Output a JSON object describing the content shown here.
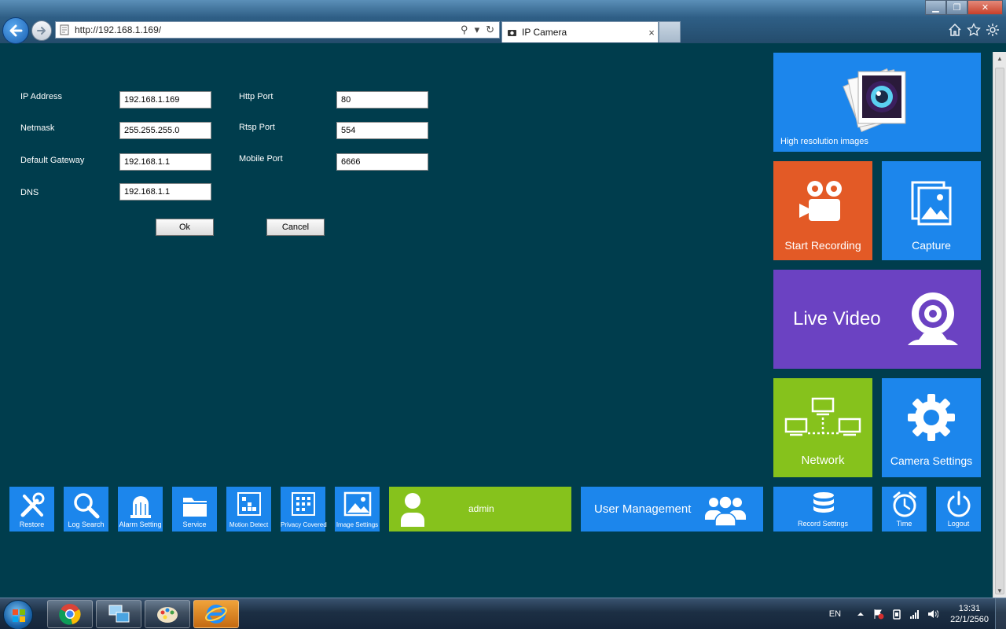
{
  "browser": {
    "url": "http://192.168.1.169/",
    "tab_title": "IP Camera",
    "tab_close": "×"
  },
  "network_form": {
    "ip_address": {
      "label": "IP Address",
      "value": "192.168.1.169"
    },
    "netmask": {
      "label": "Netmask",
      "value": "255.255.255.0"
    },
    "gateway": {
      "label": "Default Gateway",
      "value": "192.168.1.1"
    },
    "dns": {
      "label": "DNS",
      "value": "192.168.1.1"
    },
    "http_port": {
      "label": "Http Port",
      "value": "80"
    },
    "rtsp_port": {
      "label": "Rtsp Port",
      "value": "554"
    },
    "mobile_port": {
      "label": "Mobile Port",
      "value": "6666"
    },
    "ok_label": "Ok",
    "cancel_label": "Cancel"
  },
  "tiles": {
    "high_res": "High resolution images",
    "start_recording": "Start Recording",
    "capture": "Capture",
    "live_video": "Live Video",
    "network": "Network",
    "camera_settings": "Camera Settings"
  },
  "bottom_bar": {
    "restore": "Restore",
    "log_search": "Log Search",
    "alarm_setting": "Alarm Setting",
    "service": "Service",
    "motion_detect": "Motion Detect",
    "privacy_covered": "Privacy Covered",
    "image_settings": "Image Settings",
    "user": "admin",
    "user_management": "User Management",
    "record_settings": "Record Settings",
    "time": "Time",
    "logout": "Logout"
  },
  "taskbar": {
    "language": "EN",
    "time": "13:31",
    "date": "22/1/2560"
  },
  "colors": {
    "background": "#003d4d",
    "tile_blue": "#1c86ec",
    "tile_orange": "#e35a26",
    "tile_purple": "#6b42c2",
    "tile_green": "#86c21c"
  }
}
